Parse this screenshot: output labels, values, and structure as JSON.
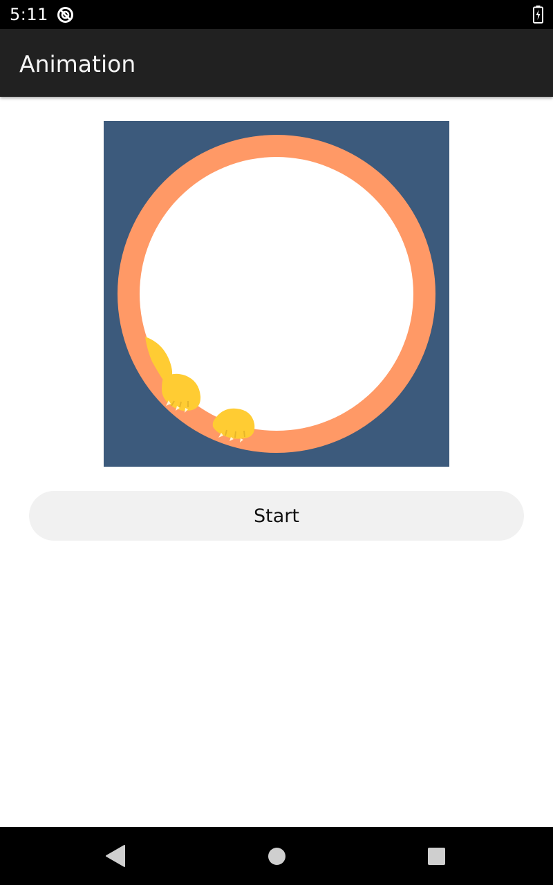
{
  "status_bar": {
    "time": "5:11",
    "icons": [
      "do-not-disturb-icon",
      "battery-charging-icon"
    ]
  },
  "app_bar": {
    "title": "Animation"
  },
  "animation": {
    "colors": {
      "background": "#3c5a7c",
      "ring": "#ff9966",
      "inner": "#ffffff",
      "paws": "#ffcc33"
    },
    "icon": "cat-paw-animation"
  },
  "start_button": {
    "label": "Start"
  },
  "nav_bar": {
    "icons": [
      "back-icon",
      "home-icon",
      "recents-icon"
    ]
  }
}
